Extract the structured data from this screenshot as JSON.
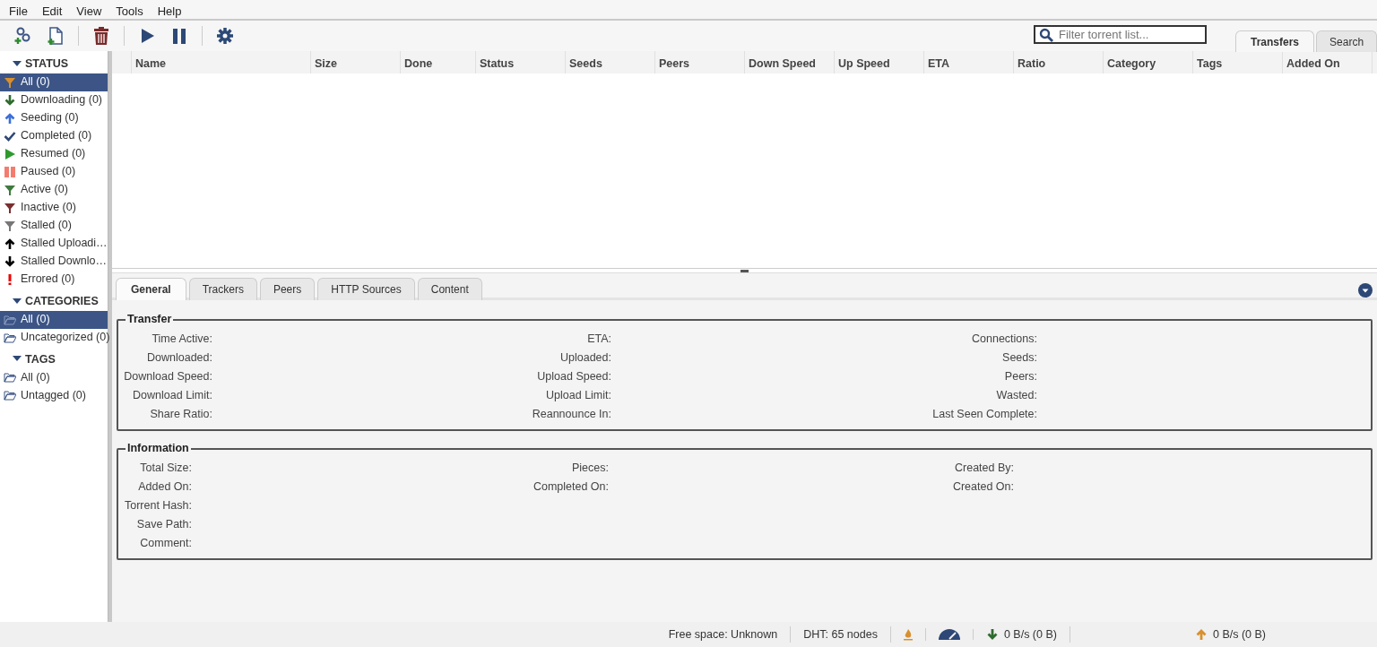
{
  "menu": [
    "File",
    "Edit",
    "View",
    "Tools",
    "Help"
  ],
  "toolbar": [
    {
      "kind": "add-link"
    },
    {
      "kind": "add-file"
    },
    {
      "kind": "sep"
    },
    {
      "kind": "delete"
    },
    {
      "kind": "sep"
    },
    {
      "kind": "resume"
    },
    {
      "kind": "pause"
    },
    {
      "kind": "sep"
    },
    {
      "kind": "options"
    }
  ],
  "filter": {
    "placeholder": "Filter torrent list..."
  },
  "main_tabs": [
    {
      "label": "Transfers",
      "selected": true
    },
    {
      "label": "Search",
      "selected": false
    }
  ],
  "sidebar": [
    {
      "title": "STATUS",
      "expanded": true,
      "items": [
        {
          "label": "All (0)",
          "kind": "all",
          "selected": true
        },
        {
          "label": "Downloading (0)",
          "kind": "downloading",
          "selected": false
        },
        {
          "label": "Seeding (0)",
          "kind": "seeding",
          "selected": false
        },
        {
          "label": "Completed (0)",
          "kind": "completed",
          "selected": false
        },
        {
          "label": "Resumed (0)",
          "kind": "resumed",
          "selected": false
        },
        {
          "label": "Paused (0)",
          "kind": "paused",
          "selected": false
        },
        {
          "label": "Active (0)",
          "kind": "active",
          "selected": false
        },
        {
          "label": "Inactive (0)",
          "kind": "inactive",
          "selected": false
        },
        {
          "label": "Stalled (0)",
          "kind": "stalled",
          "selected": false
        },
        {
          "label": "Stalled Uploadi…",
          "kind": "stalled-up",
          "selected": false
        },
        {
          "label": "Stalled Downlo…",
          "kind": "stalled-down",
          "selected": false
        },
        {
          "label": "Errored (0)",
          "kind": "errored",
          "selected": false
        }
      ]
    },
    {
      "title": "CATEGORIES",
      "expanded": true,
      "items": [
        {
          "label": "All (0)",
          "kind": "folder",
          "selected": true
        },
        {
          "label": "Uncategorized (0)",
          "kind": "folder",
          "selected": false
        }
      ]
    },
    {
      "title": "TAGS",
      "expanded": true,
      "items": [
        {
          "label": "All (0)",
          "kind": "folder",
          "selected": false
        },
        {
          "label": "Untagged (0)",
          "kind": "folder",
          "selected": false
        }
      ]
    }
  ],
  "table": {
    "columns": [
      "Name",
      "Size",
      "Done",
      "Status",
      "Seeds",
      "Peers",
      "Down Speed",
      "Up Speed",
      "ETA",
      "Ratio",
      "Category",
      "Tags",
      "Added On"
    ]
  },
  "detail_tabs": [
    {
      "label": "General",
      "selected": true
    },
    {
      "label": "Trackers",
      "selected": false
    },
    {
      "label": "Peers",
      "selected": false
    },
    {
      "label": "HTTP Sources",
      "selected": false
    },
    {
      "label": "Content",
      "selected": false
    }
  ],
  "groups": [
    {
      "title": "Transfer",
      "columns": [
        [
          "Time Active:",
          "Downloaded:",
          "Download Speed:",
          "Download Limit:",
          "Share Ratio:"
        ],
        [
          "ETA:",
          "Uploaded:",
          "Upload Speed:",
          "Upload Limit:",
          "Reannounce In:"
        ],
        [
          "Connections:",
          "Seeds:",
          "Peers:",
          "Wasted:",
          "Last Seen Complete:"
        ]
      ]
    },
    {
      "title": "Information",
      "columns": [
        [
          "Total Size:",
          "Added On:",
          "Torrent Hash:",
          "Save Path:",
          "Comment:"
        ],
        [
          "Pieces:",
          "Completed On:"
        ],
        [
          "Created By:",
          "Created On:"
        ]
      ]
    }
  ],
  "status_bar": {
    "free_space": "Free space: Unknown",
    "dht": "DHT: 65 nodes",
    "download": "0 B/s (0 B)",
    "upload": "0 B/s (0 B)"
  }
}
